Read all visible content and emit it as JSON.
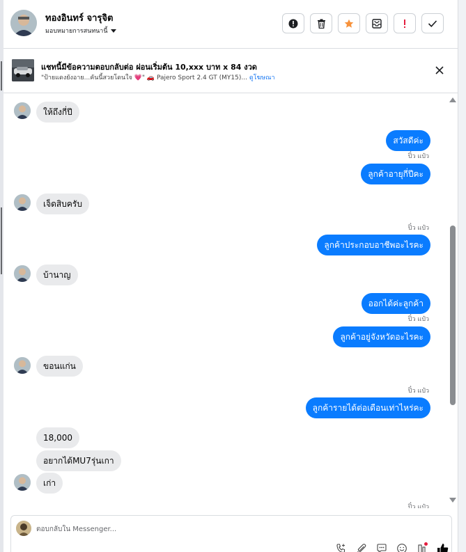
{
  "header": {
    "name": "ทองอินทร์ จารุจิต",
    "assign_label": "มอบหมายการสนทนานี้"
  },
  "actions": [
    {
      "icon": "info-icon"
    },
    {
      "icon": "trash-icon"
    },
    {
      "icon": "star-icon",
      "color": "#f7923b"
    },
    {
      "icon": "mark-unread-icon"
    },
    {
      "icon": "exclamation-icon",
      "color": "#e41e3f"
    },
    {
      "icon": "check-icon"
    }
  ],
  "listing": {
    "title": "แชทนี้มีข้อความตอบกลับต่อ ผ่อนเริ่มต้น 10,xxx บาท x 84 งวด",
    "snippet": "\"ป้ายแดงยังอาย...คันนี้สวยโดนใจ 💗\" 🚗 Pajero Sport 2.4 GT (MY15)...",
    "link": "ดูโฆษณา"
  },
  "conversation": {
    "sender_label": "ปิ๋ว แป๋ว",
    "messages": [
      {
        "dir": "in",
        "text": "ให้ถึงกี่ปี"
      },
      {
        "dir": "out",
        "text": "สวัสดีค่ะ"
      },
      {
        "dir": "out",
        "text": "ลูกค้าอายุกี่ปีคะ"
      },
      {
        "dir": "in",
        "text": "เจ็ดสิบครับ"
      },
      {
        "dir": "out",
        "text": "ลูกค้าประกอบอาชีพอะไรคะ"
      },
      {
        "dir": "in",
        "text": "บ้านาญ"
      },
      {
        "dir": "out",
        "text": "ออกได้ค่ะลูกค้า"
      },
      {
        "dir": "out",
        "text": "ลูกค้าอยู่จังหวัดอะไรคะ"
      },
      {
        "dir": "in",
        "text": "ขอนแก่น"
      },
      {
        "dir": "out",
        "text": "ลูกค้ารายได้ต่อเดือนเท่าไหร่คะ"
      },
      {
        "dir": "in",
        "text": "18,000"
      },
      {
        "dir": "in",
        "text": "อยากได้MU7รุ่นเกา"
      },
      {
        "dir": "in",
        "text": "เก่า"
      }
    ]
  },
  "composer": {
    "placeholder": "ตอบกลับใน Messenger..."
  },
  "tools": [
    {
      "icon": "phone-add-icon"
    },
    {
      "icon": "attachment-icon"
    },
    {
      "icon": "saved-reply-icon"
    },
    {
      "icon": "emoji-icon"
    },
    {
      "icon": "app-icon"
    },
    {
      "icon": "like-icon",
      "color": "#050505"
    }
  ],
  "colors": {
    "outgoing_bubble": "#0a7cff",
    "incoming_bubble": "#e9eaec",
    "link": "#1877f2"
  }
}
